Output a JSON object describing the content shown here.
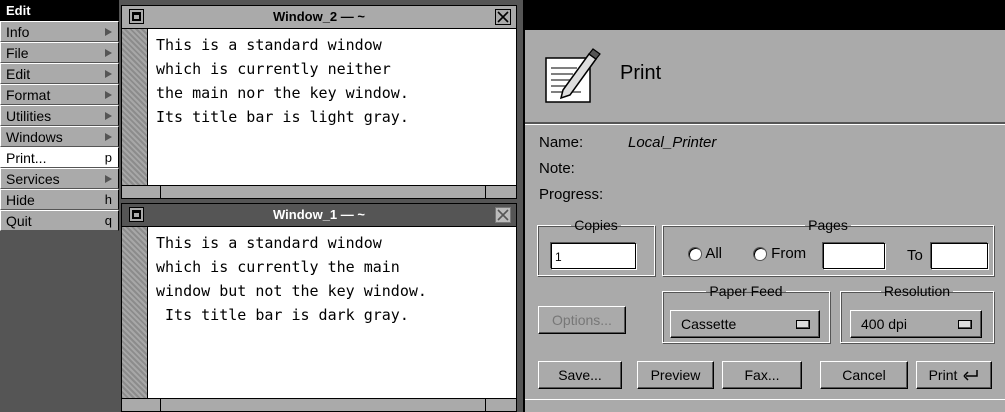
{
  "menu": {
    "title": "Edit",
    "items": [
      {
        "label": "Info",
        "key": "",
        "submenu": true
      },
      {
        "label": "File",
        "key": "",
        "submenu": true
      },
      {
        "label": "Edit",
        "key": "",
        "submenu": true
      },
      {
        "label": "Format",
        "key": "",
        "submenu": true
      },
      {
        "label": "Utilities",
        "key": "",
        "submenu": true
      },
      {
        "label": "Windows",
        "key": "",
        "submenu": true
      },
      {
        "label": "Print...",
        "key": "p",
        "submenu": false,
        "selected": true
      },
      {
        "label": "Services",
        "key": "",
        "submenu": true
      },
      {
        "label": "Hide",
        "key": "h",
        "submenu": false
      },
      {
        "label": "Quit",
        "key": "q",
        "submenu": false
      }
    ]
  },
  "window2": {
    "title": "Window_2 — ~",
    "lines": [
      "This is a standard window",
      "which is currently neither",
      "the main nor the key window.",
      "",
      "Its title bar is light gray."
    ]
  },
  "window1": {
    "title": "Window_1 — ~",
    "lines": [
      "This is a standard window",
      "which is currently the main",
      "window but not the key window.",
      "",
      " Its title bar is dark gray."
    ]
  },
  "print_panel": {
    "heading": "Print",
    "name_label": "Name:",
    "name_value": "Local_Printer",
    "note_label": "Note:",
    "progress_label": "Progress:",
    "copies": {
      "legend": "Copies",
      "value": "1"
    },
    "pages": {
      "legend": "Pages",
      "all_label": "All",
      "from_label": "From",
      "to_label": "To",
      "from_value": "",
      "to_value": ""
    },
    "options_button": "Options...",
    "paper_feed": {
      "legend": "Paper Feed",
      "value": "Cassette"
    },
    "resolution": {
      "legend": "Resolution",
      "value": "400 dpi"
    },
    "buttons": {
      "save": "Save...",
      "preview": "Preview",
      "fax": "Fax...",
      "cancel": "Cancel",
      "print": "Print"
    }
  },
  "colors": {
    "dark_gray": "#555555",
    "light_gray": "#aaaaaa",
    "black": "#000000",
    "white": "#ffffff"
  }
}
